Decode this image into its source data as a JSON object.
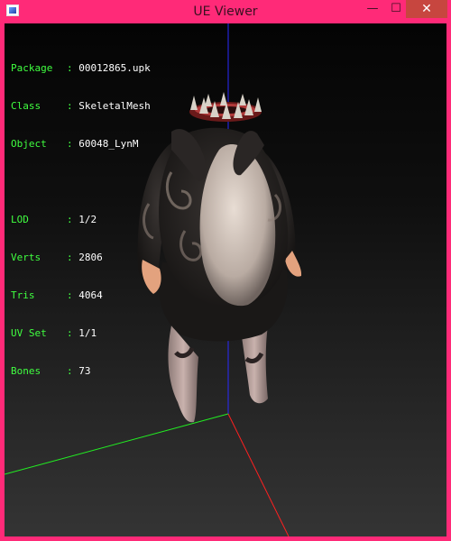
{
  "window": {
    "title": "UE Viewer",
    "minimize_glyph": "—",
    "maximize_glyph": "☐",
    "close_glyph": "✕"
  },
  "info": {
    "object": [
      {
        "key": "Package",
        "value": "00012865.upk"
      },
      {
        "key": "Class",
        "value": "SkeletalMesh"
      },
      {
        "key": "Object",
        "value": "60048_LynM"
      }
    ],
    "stats": [
      {
        "key": "LOD",
        "value": "1/2"
      },
      {
        "key": "Verts",
        "value": "2806"
      },
      {
        "key": "Tris",
        "value": "4064"
      },
      {
        "key": "UV Set",
        "value": "1/1"
      },
      {
        "key": "Bones",
        "value": "73"
      }
    ]
  },
  "colors": {
    "frame": "#ff2a78",
    "label_green": "#40ff40",
    "axis_x": "#ff2020",
    "axis_y": "#20ff20",
    "axis_z": "#2020ff"
  }
}
